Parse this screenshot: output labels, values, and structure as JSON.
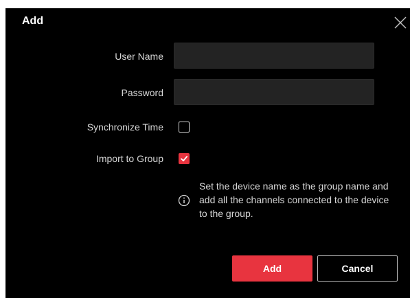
{
  "dialog": {
    "title": "Add",
    "close_icon": "close-icon"
  },
  "form": {
    "username": {
      "label": "User Name",
      "value": "",
      "placeholder": ""
    },
    "password": {
      "label": "Password",
      "value": "",
      "placeholder": ""
    },
    "sync_time": {
      "label": "Synchronize Time",
      "checked": false
    },
    "import_group": {
      "label": "Import to Group",
      "checked": true
    }
  },
  "info": {
    "icon": "info-icon",
    "lines": [
      "Set the device name as the group name and",
      "add all the channels connected to the device",
      "to the group."
    ]
  },
  "buttons": {
    "add_label": "Add",
    "cancel_label": "Cancel"
  },
  "colors": {
    "accent": "#e8343f",
    "background": "#000000",
    "input_bg": "#232323",
    "text": "#d6d6d6"
  }
}
